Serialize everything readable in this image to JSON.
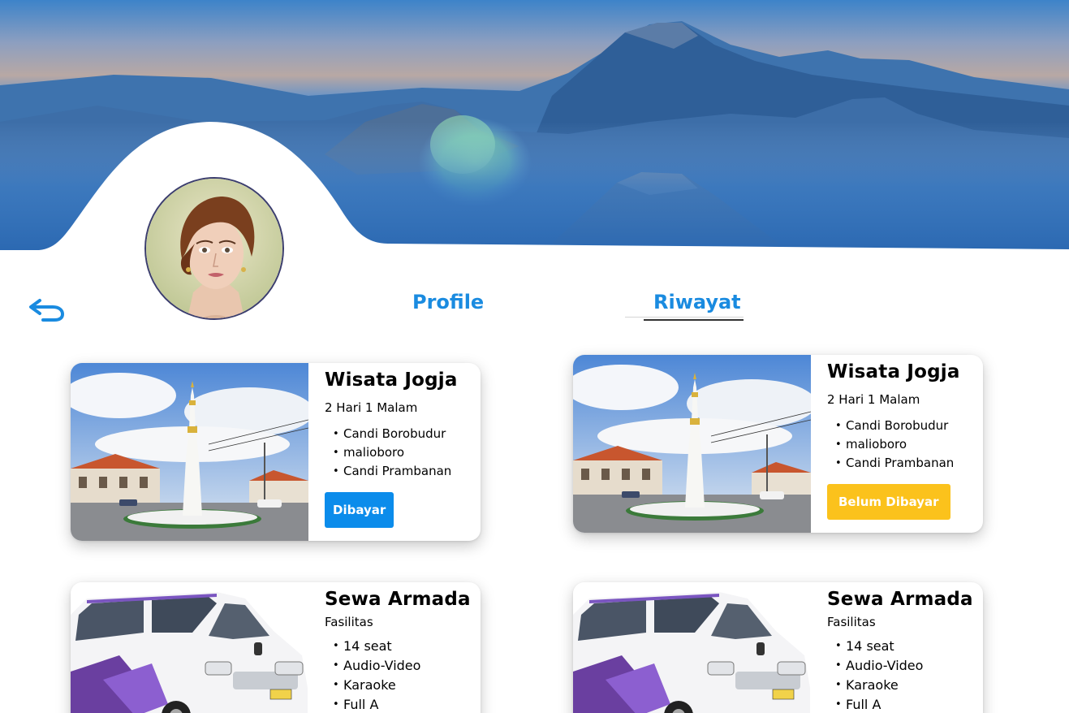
{
  "hero": {
    "image": "mountain-landscape-bromo",
    "sky_top": "#3d83c9",
    "horizon": "#b8a8a4",
    "mist": "#2d6fb8"
  },
  "profile": {
    "avatar": "woman-portrait"
  },
  "nav": {
    "back_icon": "return-arrow-icon",
    "tabs": [
      {
        "label": "Profile",
        "active": false
      },
      {
        "label": "Riwayat",
        "active": true
      }
    ],
    "accent": "#1a8be0"
  },
  "cards": [
    {
      "title": "Wisata Jogja",
      "image": "tugu-jogja-monument",
      "subtitle": "2 Hari 1 Malam",
      "items": [
        "Candi Borobudur",
        "malioboro",
        "Candi Prambanan"
      ],
      "status": {
        "label": "Dibayar",
        "color": "#0b8ceb"
      }
    },
    {
      "title": "Wisata Jogja",
      "image": "tugu-jogja-monument",
      "subtitle": "2 Hari 1 Malam",
      "items": [
        "Candi Borobudur",
        "malioboro",
        "Candi Prambanan"
      ],
      "status": {
        "label": "Belum Dibayar",
        "color": "#fbc21c"
      }
    },
    {
      "title": "Sewa Armada",
      "image": "white-minibus",
      "subtitle": "Fasilitas",
      "items": [
        "14 seat",
        "Audio-Video",
        "Karaoke",
        "Full A"
      ]
    },
    {
      "title": "Sewa Armada",
      "image": "white-minibus",
      "subtitle": "Fasilitas",
      "items": [
        "14 seat",
        "Audio-Video",
        "Karaoke",
        "Full A"
      ]
    }
  ]
}
